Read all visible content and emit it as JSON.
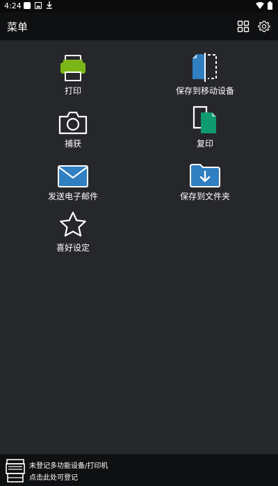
{
  "status_bar": {
    "time": "4:24",
    "left_icons": [
      "notification-square-icon",
      "photo-icon",
      "download-icon"
    ],
    "right_icons": [
      "wifi-icon",
      "battery-icon"
    ]
  },
  "app_bar": {
    "title": "菜单",
    "actions": [
      "grid-icon",
      "gear-icon"
    ]
  },
  "menu": {
    "items": [
      {
        "label": "打印",
        "icon": "printer-icon"
      },
      {
        "label": "保存到移动设备",
        "icon": "save-to-mobile-icon"
      },
      {
        "label": "捕获",
        "icon": "camera-icon"
      },
      {
        "label": "复印",
        "icon": "copy-icon"
      },
      {
        "label": "发送电子邮件",
        "icon": "email-icon"
      },
      {
        "label": "保存到文件夹",
        "icon": "folder-download-icon"
      },
      {
        "label": "喜好设定",
        "icon": "star-icon"
      }
    ]
  },
  "footer": {
    "line1": "未登记多功能设备/打印机",
    "line2": "点击此处可登记",
    "icon": "multifunction-printer-icon"
  },
  "colors": {
    "background": "#26272b",
    "bar": "#0f1012",
    "printer_green": "#7cb518",
    "icon_blue": "#2f7fc1",
    "icon_teal": "#0f9a6f"
  }
}
